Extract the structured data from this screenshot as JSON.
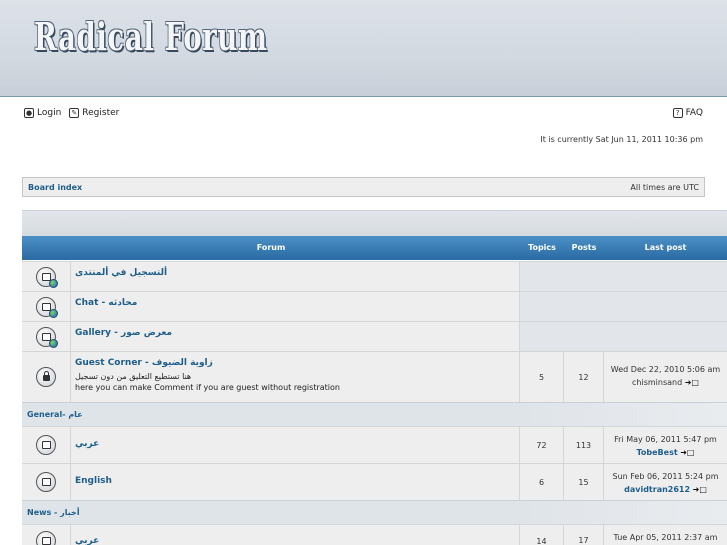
{
  "header": {
    "logo_text": "Radical Forum"
  },
  "toplinks": {
    "login": "Login",
    "register": "Register",
    "faq": "FAQ"
  },
  "current_time": "It is currently Sat Jun 11, 2011 10:36 pm",
  "navbar": {
    "board_index": "Board index",
    "timezone": "All times are UTC"
  },
  "table_header": {
    "forum": "Forum",
    "topics": "Topics",
    "posts": "Posts",
    "last_post": "Last post"
  },
  "forums_top": [
    {
      "title": "ألتسجيل في ألمنتدى",
      "icon": "forum-globe-icon"
    },
    {
      "title": "Chat - محادثه",
      "icon": "forum-globe-icon"
    },
    {
      "title": "Gallery - معرض صور",
      "icon": "forum-globe-icon"
    },
    {
      "title": "Guest Corner - زاوية الضيوف",
      "desc1": "هنا تستطيع التعليق من دون تسجيل",
      "desc2": "here you can make Comment if you are guest without registration",
      "topics": "5",
      "posts": "12",
      "last_date": "Wed Dec 22, 2010 5:06 am",
      "last_user": "chisminsand",
      "icon": "forum-locked-icon"
    }
  ],
  "categories": [
    {
      "title": "General- عام",
      "forums": [
        {
          "title": "عربي",
          "topics": "72",
          "posts": "113",
          "last_date": "Fri May 06, 2011 5:47 pm",
          "last_user": "TobeBest"
        },
        {
          "title": "English",
          "topics": "6",
          "posts": "15",
          "last_date": "Sun Feb 06, 2011 5:24 pm",
          "last_user": "davidtran2612"
        }
      ]
    },
    {
      "title": "News - أخبار",
      "forums": [
        {
          "title": "عربي",
          "topics": "14",
          "posts": "17",
          "last_date": "Tue Apr 05, 2011 2:37 am",
          "last_user": ""
        }
      ]
    }
  ],
  "go_icon_glyph": "➜□"
}
